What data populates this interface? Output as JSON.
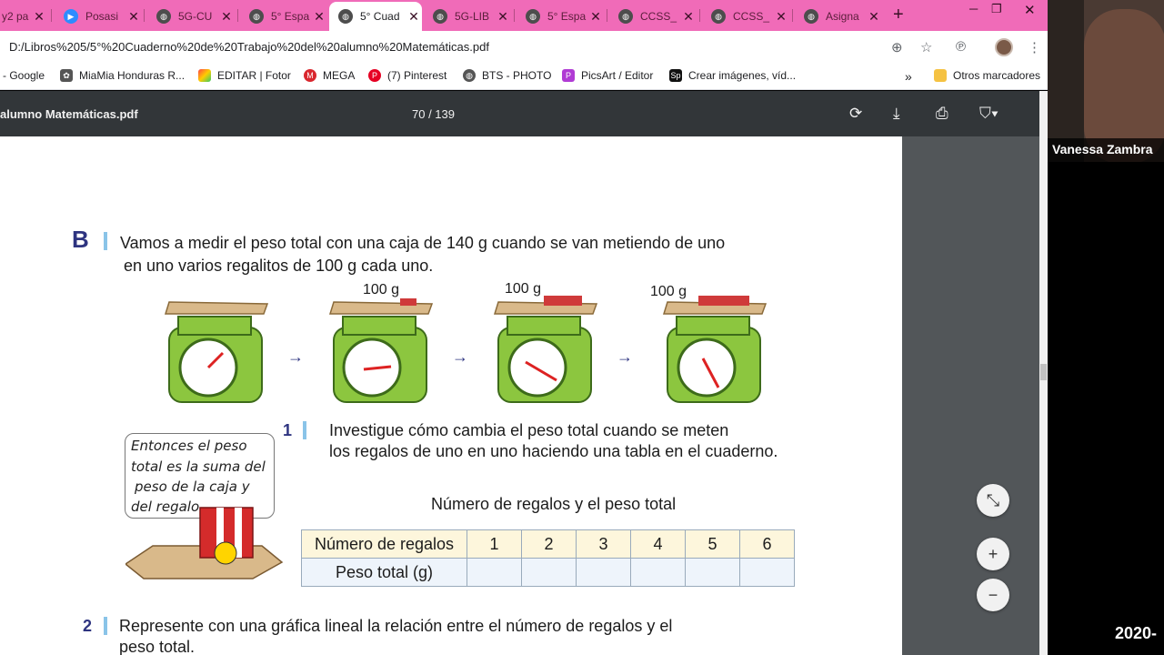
{
  "tabs": [
    {
      "title": "y2 pa",
      "icon": "page-icon"
    },
    {
      "title": "Posasi",
      "icon": "zoom-icon"
    },
    {
      "title": "5G-CU",
      "icon": "globe-icon"
    },
    {
      "title": "5° Espa",
      "icon": "globe-icon"
    },
    {
      "title": "5° Cuad",
      "icon": "globe-icon",
      "active": true
    },
    {
      "title": "5G-LIB",
      "icon": "globe-icon"
    },
    {
      "title": "5° Espa",
      "icon": "globe-icon"
    },
    {
      "title": "CCSS_",
      "icon": "globe-icon"
    },
    {
      "title": "CCSS_",
      "icon": "globe-icon"
    },
    {
      "title": "Asigna",
      "icon": "globe-icon"
    }
  ],
  "address": {
    "url": "D:/Libros%205/5°%20Cuaderno%20de%20Trabajo%20del%20alumno%20Matemáticas.pdf"
  },
  "bookmarks": [
    {
      "label": "- Google"
    },
    {
      "label": "MiaMia Honduras R..."
    },
    {
      "label": "EDITAR | Fotor"
    },
    {
      "label": "MEGA"
    },
    {
      "label": "(7) Pinterest"
    },
    {
      "label": "BTS - PHOTO"
    },
    {
      "label": "PicsArt / Editor"
    },
    {
      "label": "Crear imágenes, víd..."
    }
  ],
  "bookmarks_more": "»",
  "other_bookmarks": "Otros marcadores",
  "pdf": {
    "title": "alumno Matemáticas.pdf",
    "page_indicator": "70 / 139"
  },
  "page": {
    "section": "B",
    "intro_line1": "Vamos a medir el peso total con una caja de 140 g cuando se van metiendo de uno",
    "intro_line2": "en uno varios regalitos de 100 g cada uno.",
    "weight_labels": [
      "100 g",
      "100 g",
      "100 g"
    ],
    "q1_number": "1",
    "q1_line1": "Investigue cómo cambia el peso total cuando se meten",
    "q1_line2": "los regalos de uno en uno haciendo una tabla en el cuaderno.",
    "speech_lines": [
      "Entonces el peso",
      "total es la suma del",
      "peso de la caja y",
      "del regalo."
    ],
    "table_title": "Número de regalos y el peso total",
    "table_row1_header": "Número de  regalos",
    "table_row2_header": "Peso total (g)",
    "table_columns": [
      "1",
      "2",
      "3",
      "4",
      "5",
      "6"
    ],
    "q2_number": "2",
    "q2_line1": "Represente con una gráfica lineal la relación entre el número de regalos y el",
    "q2_line2": "peso total."
  },
  "webcam": {
    "name": "Vanessa Zambra"
  },
  "date_stamp": "2020-",
  "colors": {
    "tabbar": "#f06bb8",
    "scale_green": "#8cc63f",
    "section_blue": "#2e3480"
  }
}
